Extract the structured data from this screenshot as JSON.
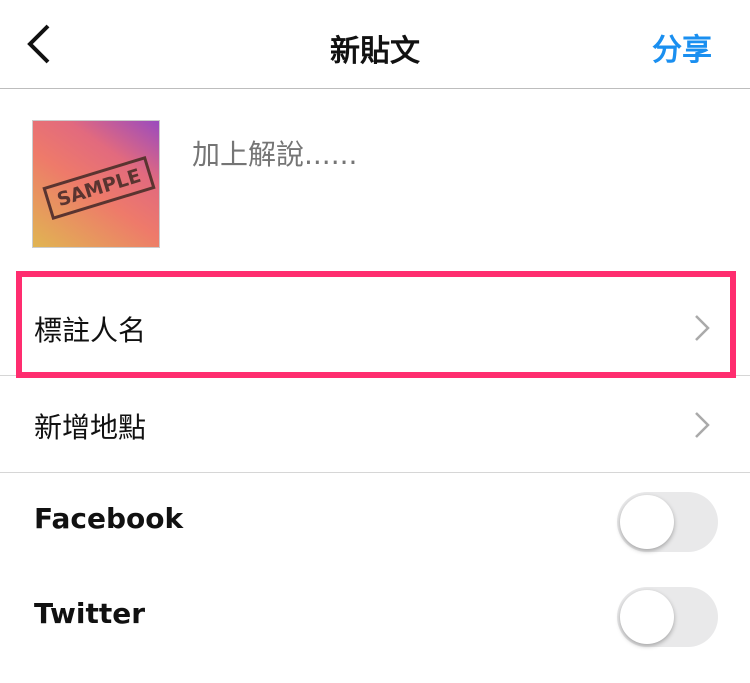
{
  "header": {
    "title": "新貼文",
    "share_label": "分享"
  },
  "post": {
    "thumbnail_text": "SAMPLE",
    "caption_placeholder": "加上解說......"
  },
  "rows": [
    {
      "label": "標註人名"
    },
    {
      "label": "新增地點"
    }
  ],
  "toggles": [
    {
      "label": "Facebook",
      "on": false
    },
    {
      "label": "Twitter",
      "on": false
    }
  ],
  "colors": {
    "accent": "#1a8ff0",
    "highlight": "#ff2d6f"
  }
}
